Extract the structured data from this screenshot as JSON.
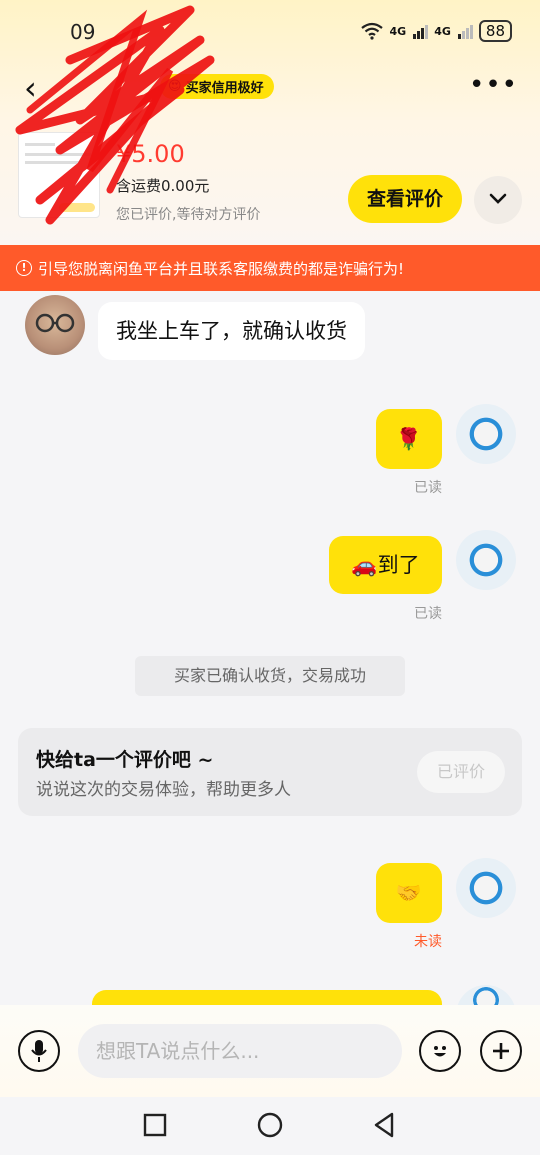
{
  "status_bar": {
    "time": "09",
    "battery": "88",
    "network": [
      "4G",
      "4G"
    ]
  },
  "header": {
    "credit_badge": "买家信用极好",
    "price": "¥5.00",
    "shipping": "含运费0.00元",
    "eval_status": "您已评价,等待对方评价",
    "view_eval_button": "查看评价"
  },
  "warning": {
    "text": "引导您脱离闲鱼平台并且联系客服缴费的都是诈骗行为!"
  },
  "messages": [
    {
      "side": "left",
      "text": "我坐上车了，就确认收货"
    },
    {
      "side": "right",
      "text": "🌹",
      "status": "已读"
    },
    {
      "side": "right",
      "text": "🚗到了",
      "status": "已读"
    }
  ],
  "system_message": "买家已确认收货，交易成功",
  "review_card": {
    "title": "快给ta一个评价吧 ~",
    "subtitle": "说说这次的交易体验，帮助更多人",
    "button": "已评价"
  },
  "messages2": [
    {
      "side": "right",
      "text": "🤝",
      "status": "未读"
    }
  ],
  "input": {
    "placeholder": "想跟TA说点什么..."
  },
  "colors": {
    "accent": "#ffe10a",
    "warning": "#ff5a2a",
    "price": "#ff3b30"
  },
  "icons": [
    "back-icon",
    "more-icon",
    "chevron-down-icon",
    "microphone-icon",
    "emoji-icon",
    "plus-icon",
    "nav-recent-icon",
    "nav-home-icon",
    "nav-back-icon"
  ]
}
